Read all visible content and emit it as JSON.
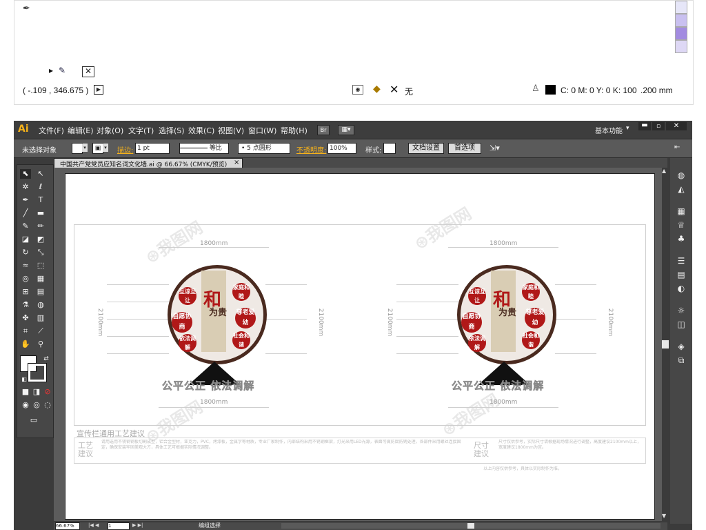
{
  "info": {
    "coords": "( -.109 , 346.675 )",
    "color_readout": "C: 0 M: 0 Y: 0 K: 100",
    "stroke_value": ".200 mm",
    "none_label": "无"
  },
  "app": {
    "logo": "Ai",
    "menus": [
      "文件(F)",
      "编辑(E)",
      "对象(O)",
      "文字(T)",
      "选择(S)",
      "效果(C)",
      "视图(V)",
      "窗口(W)",
      "帮助(H)"
    ],
    "bridge_label": "Br",
    "workspace": "基本功能"
  },
  "control": {
    "selection": "未选择对象",
    "stroke_label": "描边:",
    "stroke_value": "1 pt",
    "profile_label": "等比",
    "brush_label": "5 点圆形",
    "opacity_label": "不透明度:",
    "opacity_value": "100%",
    "style_label": "样式:",
    "doc_setup": "文档设置",
    "preferences": "首选项"
  },
  "document": {
    "tab_title": "中国共产党党员应知名词文化墙.ai @ 66.67% (CMYK/预览)",
    "tab_close": "×"
  },
  "artwork": {
    "dim_top": "1800mm",
    "dim_bottom": "1800mm",
    "dim_side": "2100mm",
    "banner_text": "公平公正 依法调解",
    "center_char_1": "和",
    "center_char_2": "为贵",
    "badges": [
      "互谅互让",
      "自愿协商",
      "家庭和睦",
      "尊老爱幼",
      "社会和谐",
      "依法调解"
    ],
    "section_title": "宣传栏通用工艺建议",
    "craft_label": "工艺建议",
    "size_label": "尺寸建议",
    "craft_text": "请用选用不锈钢钢板切割成型，铝合金型材，亚克力，PVC，烤漆板，金属字等材质，专业厂家制作，内部结构采用不锈钢框架，灯光采用LED光源，表面可做防腐防锈处理，各部件采用螺丝连接固定，确保安装牢固美观大方，具体工艺可根据实际情况调整。",
    "size_text": "尺寸仅供参考，实际尺寸请根据现场情况进行调整，高度建议2100mm以上，宽度建议1800mm为宜。",
    "footnote": "以上内容仅供参考，具体以实际制作为准。"
  },
  "statusbar": {
    "zoom": "66.67%",
    "page": "1",
    "mode": "编组选择"
  },
  "colors": {
    "accent_red": "#b01818",
    "brown": "#4a2a1f",
    "app_bg": "#3b3b3b",
    "canvas_bg": "#5c5c5c"
  }
}
